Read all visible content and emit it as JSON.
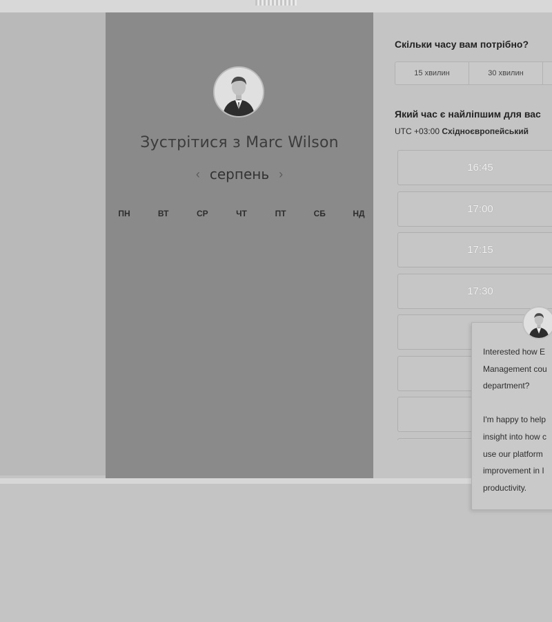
{
  "scheduler": {
    "meet_title": "Зустрітися з Marc Wilson",
    "month": "серпень",
    "prev_month_icon": "chevron-left-icon",
    "next_month_icon": "chevron-right-icon",
    "weekdays": [
      "ПН",
      "ВТ",
      "СР",
      "ЧТ",
      "ПТ",
      "СБ",
      "НД"
    ]
  },
  "duration": {
    "question": "Скільки часу вам потрібно?",
    "options": [
      "15 хвилин",
      "30 хвилин"
    ]
  },
  "time": {
    "question": "Який час є найліпшим для вас",
    "timezone_offset": "UTC +03:00",
    "timezone_name": "Східноєвропейський",
    "slots": [
      "16:45",
      "17:00",
      "17:15",
      "17:30",
      "",
      "",
      "",
      ""
    ]
  },
  "chat": {
    "line1": "Interested how E",
    "line2": "Management cou",
    "line3": "department?",
    "line4": "I'm happy to help",
    "line5": "insight into how c",
    "line6": "use our platform",
    "line7": "improvement in I",
    "line8": "productivity."
  }
}
